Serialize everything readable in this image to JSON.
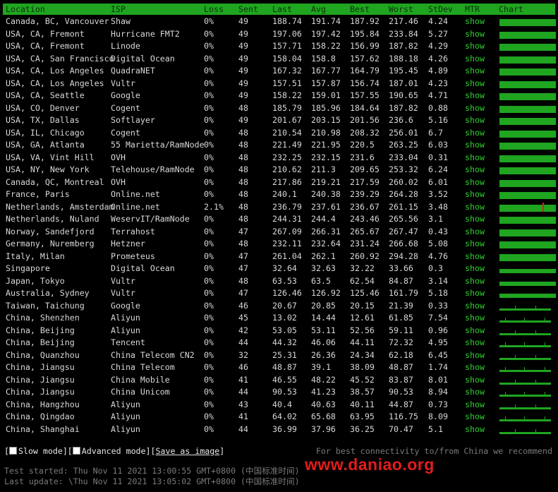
{
  "columns": [
    "Location",
    "ISP",
    "Loss",
    "Sent",
    "Last",
    "Avg",
    "Best",
    "Worst",
    "StDev",
    "MTR",
    "Chart"
  ],
  "show_label": "show",
  "colors": {
    "header_bg": "#1fa51f",
    "link": "#2ed12e",
    "chart_bar": "#1fa51f",
    "spike": "#e31c1c",
    "watermark": "#e31c1c"
  },
  "rows": [
    {
      "location": "Canada, BC, Vancouver",
      "isp": "Shaw",
      "loss": "0%",
      "sent": "49",
      "last": "188.74",
      "avg": "191.74",
      "best": "187.92",
      "worst": "217.46",
      "stdev": "4.24",
      "chart": "full"
    },
    {
      "location": "USA, CA, Fremont",
      "isp": "Hurricane FMT2",
      "loss": "0%",
      "sent": "49",
      "last": "197.06",
      "avg": "197.42",
      "best": "195.84",
      "worst": "233.84",
      "stdev": "5.27",
      "chart": "full"
    },
    {
      "location": "USA, CA, Fremont",
      "isp": "Linode",
      "loss": "0%",
      "sent": "49",
      "last": "157.71",
      "avg": "158.22",
      "best": "156.99",
      "worst": "187.82",
      "stdev": "4.29",
      "chart": "full"
    },
    {
      "location": "USA, CA, San Francisco",
      "isp": "Digital Ocean",
      "loss": "0%",
      "sent": "49",
      "last": "158.04",
      "avg": "158.8",
      "best": "157.62",
      "worst": "188.18",
      "stdev": "4.26",
      "chart": "full"
    },
    {
      "location": "USA, CA, Los Angeles",
      "isp": "QuadraNET",
      "loss": "0%",
      "sent": "49",
      "last": "167.32",
      "avg": "167.77",
      "best": "164.79",
      "worst": "195.45",
      "stdev": "4.89",
      "chart": "full"
    },
    {
      "location": "USA, CA, Los Angeles",
      "isp": "Vultr",
      "loss": "0%",
      "sent": "49",
      "last": "157.51",
      "avg": "157.87",
      "best": "156.74",
      "worst": "187.01",
      "stdev": "4.23",
      "chart": "full"
    },
    {
      "location": "USA, CA, Seattle",
      "isp": "Google",
      "loss": "0%",
      "sent": "49",
      "last": "158.22",
      "avg": "159.01",
      "best": "157.55",
      "worst": "190.65",
      "stdev": "4.71",
      "chart": "full"
    },
    {
      "location": "USA, CO, Denver",
      "isp": "Cogent",
      "loss": "0%",
      "sent": "48",
      "last": "185.79",
      "avg": "185.96",
      "best": "184.64",
      "worst": "187.82",
      "stdev": "0.88",
      "chart": "full"
    },
    {
      "location": "USA, TX, Dallas",
      "isp": "Softlayer",
      "loss": "0%",
      "sent": "49",
      "last": "201.67",
      "avg": "203.15",
      "best": "201.56",
      "worst": "236.6",
      "stdev": "5.16",
      "chart": "full"
    },
    {
      "location": "USA, IL, Chicago",
      "isp": "Cogent",
      "loss": "0%",
      "sent": "48",
      "last": "210.54",
      "avg": "210.98",
      "best": "208.32",
      "worst": "256.01",
      "stdev": "6.7",
      "chart": "full"
    },
    {
      "location": "USA, GA, Atlanta",
      "isp": "55 Marietta/RamNode",
      "loss": "0%",
      "sent": "48",
      "last": "221.49",
      "avg": "221.95",
      "best": "220.5",
      "worst": "263.25",
      "stdev": "6.03",
      "chart": "full"
    },
    {
      "location": "USA, VA, Vint Hill",
      "isp": "OVH",
      "loss": "0%",
      "sent": "48",
      "last": "232.25",
      "avg": "232.15",
      "best": "231.6",
      "worst": "233.04",
      "stdev": "0.31",
      "chart": "full"
    },
    {
      "location": "USA, NY, New York",
      "isp": "Telehouse/RamNode",
      "loss": "0%",
      "sent": "48",
      "last": "210.62",
      "avg": "211.3",
      "best": "209.65",
      "worst": "253.32",
      "stdev": "6.24",
      "chart": "full"
    },
    {
      "location": "Canada, QC, Montreal",
      "isp": "OVH",
      "loss": "0%",
      "sent": "48",
      "last": "217.86",
      "avg": "219.21",
      "best": "217.59",
      "worst": "260.02",
      "stdev": "6.01",
      "chart": "full"
    },
    {
      "location": "France, Paris",
      "isp": "Online.net",
      "loss": "0%",
      "sent": "48",
      "last": "240.1",
      "avg": "240.38",
      "best": "239.29",
      "worst": "264.28",
      "stdev": "3.52",
      "chart": "full"
    },
    {
      "location": "Netherlands, Amsterdam",
      "isp": "Online.net",
      "loss": "2.1%",
      "sent": "48",
      "last": "236.79",
      "avg": "237.61",
      "best": "236.67",
      "worst": "261.15",
      "stdev": "3.48",
      "chart": "loss"
    },
    {
      "location": "Netherlands, Nuland",
      "isp": "WeservIT/RamNode",
      "loss": "0%",
      "sent": "48",
      "last": "244.31",
      "avg": "244.4",
      "best": "243.46",
      "worst": "265.56",
      "stdev": "3.1",
      "chart": "full"
    },
    {
      "location": "Norway, Sandefjord",
      "isp": "Terrahost",
      "loss": "0%",
      "sent": "47",
      "last": "267.09",
      "avg": "266.31",
      "best": "265.67",
      "worst": "267.47",
      "stdev": "0.43",
      "chart": "full"
    },
    {
      "location": "Germany, Nuremberg",
      "isp": "Hetzner",
      "loss": "0%",
      "sent": "48",
      "last": "232.11",
      "avg": "232.64",
      "best": "231.24",
      "worst": "266.68",
      "stdev": "5.08",
      "chart": "full"
    },
    {
      "location": "Italy, Milan",
      "isp": "Prometeus",
      "loss": "0%",
      "sent": "47",
      "last": "261.04",
      "avg": "262.1",
      "best": "260.92",
      "worst": "294.28",
      "stdev": "4.76",
      "chart": "full"
    },
    {
      "location": "Singapore",
      "isp": "Digital Ocean",
      "loss": "0%",
      "sent": "47",
      "last": "32.64",
      "avg": "32.63",
      "best": "32.22",
      "worst": "33.66",
      "stdev": "0.3",
      "chart": "mid"
    },
    {
      "location": "Japan, Tokyo",
      "isp": "Vultr",
      "loss": "0%",
      "sent": "48",
      "last": "63.53",
      "avg": "63.5",
      "best": "62.54",
      "worst": "84.87",
      "stdev": "3.14",
      "chart": "mid"
    },
    {
      "location": "Australia, Sydney",
      "isp": "Vultr",
      "loss": "0%",
      "sent": "47",
      "last": "126.46",
      "avg": "126.92",
      "best": "125.46",
      "worst": "161.79",
      "stdev": "5.18",
      "chart": "mid"
    },
    {
      "location": "Taiwan, Taichung",
      "isp": "Google",
      "loss": "0%",
      "sent": "46",
      "last": "20.67",
      "avg": "20.85",
      "best": "20.15",
      "worst": "21.39",
      "stdev": "0.33",
      "chart": "low"
    },
    {
      "location": "China, Shenzhen",
      "isp": "Aliyun",
      "loss": "0%",
      "sent": "45",
      "last": "13.02",
      "avg": "14.44",
      "best": "12.61",
      "worst": "61.85",
      "stdev": "7.54",
      "chart": "low"
    },
    {
      "location": "China, Beijing",
      "isp": "Aliyun",
      "loss": "0%",
      "sent": "42",
      "last": "53.05",
      "avg": "53.11",
      "best": "52.56",
      "worst": "59.11",
      "stdev": "0.96",
      "chart": "low"
    },
    {
      "location": "China, Beijing",
      "isp": "Tencent",
      "loss": "0%",
      "sent": "44",
      "last": "44.32",
      "avg": "46.06",
      "best": "44.11",
      "worst": "72.32",
      "stdev": "4.95",
      "chart": "low"
    },
    {
      "location": "China, Quanzhou",
      "isp": "China Telecom CN2",
      "loss": "0%",
      "sent": "32",
      "last": "25.31",
      "avg": "26.36",
      "best": "24.34",
      "worst": "62.18",
      "stdev": "6.45",
      "chart": "low"
    },
    {
      "location": "China, Jiangsu",
      "isp": "China Telecom",
      "loss": "0%",
      "sent": "46",
      "last": "48.87",
      "avg": "39.1",
      "best": "38.09",
      "worst": "48.87",
      "stdev": "1.74",
      "chart": "low"
    },
    {
      "location": "China, Jiangsu",
      "isp": "China Mobile",
      "loss": "0%",
      "sent": "41",
      "last": "46.55",
      "avg": "48.22",
      "best": "45.52",
      "worst": "83.87",
      "stdev": "8.01",
      "chart": "low"
    },
    {
      "location": "China, Jiangsu",
      "isp": "China Unicom",
      "loss": "0%",
      "sent": "44",
      "last": "90.53",
      "avg": "41.23",
      "best": "38.57",
      "worst": "90.53",
      "stdev": "8.94",
      "chart": "low"
    },
    {
      "location": "China, Hangzhou",
      "isp": "Aliyun",
      "loss": "0%",
      "sent": "43",
      "last": "40.4",
      "avg": "40.63",
      "best": "40.11",
      "worst": "44.87",
      "stdev": "0.73",
      "chart": "low"
    },
    {
      "location": "China, Qingdao",
      "isp": "Aliyun",
      "loss": "0%",
      "sent": "41",
      "last": "64.02",
      "avg": "65.68",
      "best": "63.95",
      "worst": "116.75",
      "stdev": "8.09",
      "chart": "low"
    },
    {
      "location": "China, Shanghai",
      "isp": "Aliyun",
      "loss": "0%",
      "sent": "44",
      "last": "36.99",
      "avg": "37.96",
      "best": "36.25",
      "worst": "70.47",
      "stdev": "5.1",
      "chart": "low"
    }
  ],
  "footer": {
    "bracket_open": "[",
    "slow_mode": "Slow mode",
    "sep": "][",
    "advanced_mode": "Advanced mode",
    "save_as_image": "Save as image",
    "bracket_close": "]",
    "recommend": "For best connectivity to/from China we recommend",
    "test_started": "Test started: Thu Nov 11 2021 13:00:55 GMT+0800 (中国标准时间)",
    "last_update": "Last update: \\Thu Nov 11 2021 13:05:02 GMT+0800 (中国标准时间)"
  },
  "watermark": "www.daniao.org"
}
